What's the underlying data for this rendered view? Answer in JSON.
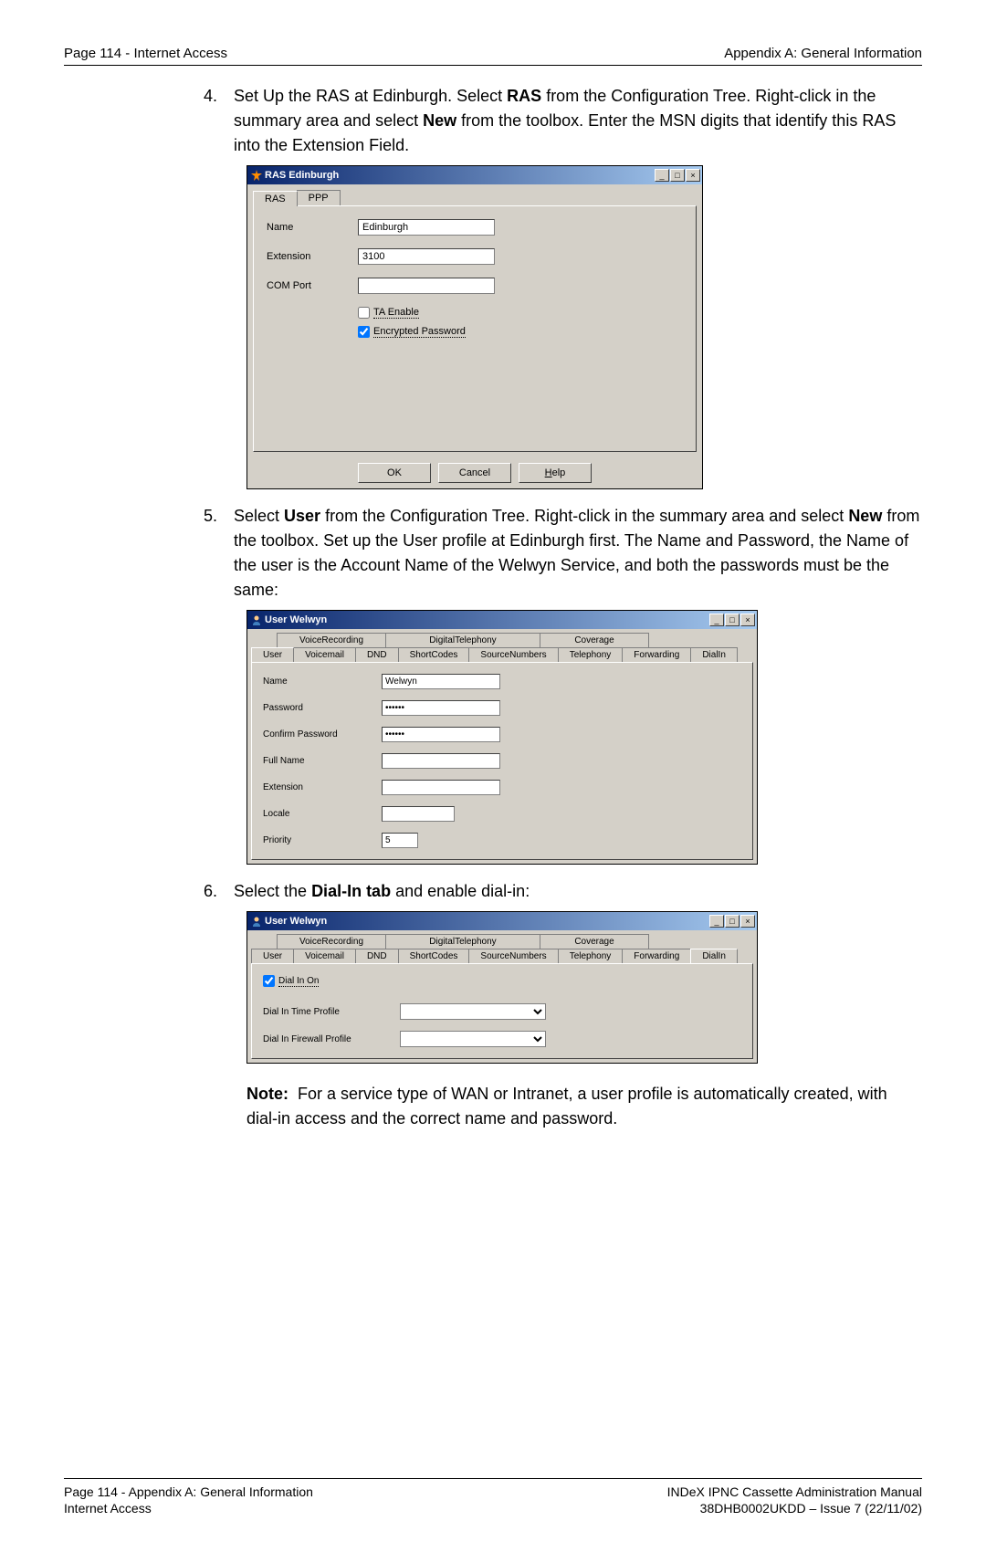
{
  "header": {
    "left": "Page 114 - Internet Access",
    "right": "Appendix A: General Information"
  },
  "steps": {
    "s4": {
      "num": "4.",
      "text_prefix": "Set Up the RAS at Edinburgh. Select ",
      "bold1": "RAS",
      "text_mid": " from the Configuration Tree. Right-click in the summary area and select ",
      "bold2": "New",
      "text_suffix": " from the toolbox. Enter the MSN digits that identify this RAS into the Extension Field."
    },
    "s5": {
      "num": "5.",
      "text_prefix": "Select ",
      "bold1": "User",
      "text_mid": " from the Configuration Tree. Right-click in the summary area and select ",
      "bold2": "New",
      "text_suffix": " from the toolbox. Set up the User profile at Edinburgh first. The Name and Password, the Name of the user is the Account Name of the Welwyn Service, and both the passwords must be the same:"
    },
    "s6": {
      "num": "6.",
      "text_prefix": "Select the ",
      "bold1": "Dial-In tab",
      "text_suffix": " and enable dial-in:"
    }
  },
  "note": {
    "label": "Note:",
    "text": "For a service type of WAN or Intranet, a user profile is automatically created, with dial-in access and the correct name and password."
  },
  "ras_dialog": {
    "title": "RAS Edinburgh",
    "tabs": [
      "RAS",
      "PPP"
    ],
    "fields": {
      "name_lbl": "Name",
      "name_val": "Edinburgh",
      "ext_lbl": "Extension",
      "ext_val": "3100",
      "com_lbl": "COM Port",
      "com_val": ""
    },
    "checks": {
      "ta": "TA Enable",
      "enc": "Encrypted Password"
    },
    "buttons": {
      "ok": "OK",
      "cancel": "Cancel",
      "help": "Help"
    }
  },
  "user_dialog1": {
    "title": "User Welwyn",
    "row1_tabs": [
      "VoiceRecording",
      "DigitalTelephony",
      "Coverage"
    ],
    "row2_tabs": [
      "User",
      "Voicemail",
      "DND",
      "ShortCodes",
      "SourceNumbers",
      "Telephony",
      "Forwarding",
      "DialIn"
    ],
    "fields": {
      "name_lbl": "Name",
      "name_val": "Welwyn",
      "pwd_lbl": "Password",
      "pwd_val": "******",
      "cpwd_lbl": "Confirm Password",
      "cpwd_val": "******",
      "fname_lbl": "Full Name",
      "fname_val": "",
      "ext_lbl": "Extension",
      "ext_val": "",
      "loc_lbl": "Locale",
      "loc_val": "",
      "pri_lbl": "Priority",
      "pri_val": "5"
    }
  },
  "user_dialog2": {
    "title": "User Welwyn",
    "row1_tabs": [
      "VoiceRecording",
      "DigitalTelephony",
      "Coverage"
    ],
    "row2_tabs": [
      "User",
      "Voicemail",
      "DND",
      "ShortCodes",
      "SourceNumbers",
      "Telephony",
      "Forwarding",
      "DialIn"
    ],
    "dialin_chk": "Dial In On",
    "time_lbl": "Dial In Time Profile",
    "fw_lbl": "Dial In Firewall Profile"
  },
  "footer": {
    "left1": "Page 114 - Appendix A: General Information",
    "right1": "INDeX IPNC Cassette Administration Manual",
    "left2": "Internet Access",
    "right2": "38DHB0002UKDD – Issue 7 (22/11/02)"
  }
}
